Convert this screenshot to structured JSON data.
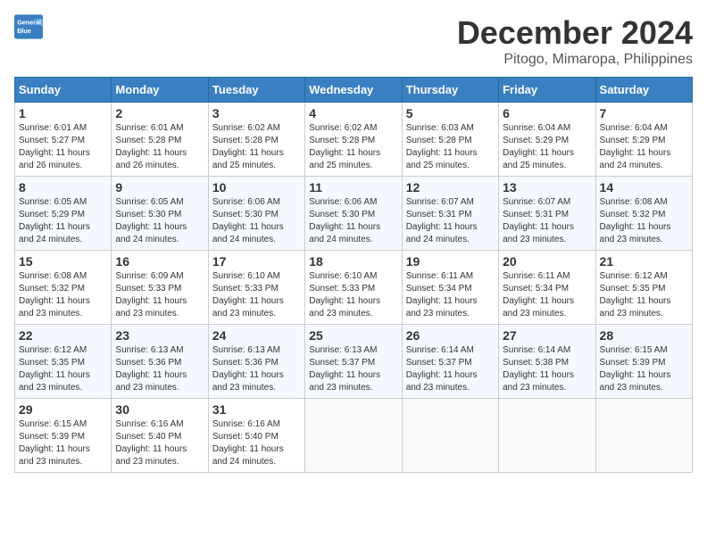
{
  "logo": {
    "line1": "General",
    "line2": "Blue"
  },
  "title": "December 2024",
  "subtitle": "Pitogo, Mimaropa, Philippines",
  "headers": [
    "Sunday",
    "Monday",
    "Tuesday",
    "Wednesday",
    "Thursday",
    "Friday",
    "Saturday"
  ],
  "weeks": [
    [
      {
        "day": "1",
        "info": "Sunrise: 6:01 AM\nSunset: 5:27 PM\nDaylight: 11 hours\nand 26 minutes."
      },
      {
        "day": "2",
        "info": "Sunrise: 6:01 AM\nSunset: 5:28 PM\nDaylight: 11 hours\nand 26 minutes."
      },
      {
        "day": "3",
        "info": "Sunrise: 6:02 AM\nSunset: 5:28 PM\nDaylight: 11 hours\nand 25 minutes."
      },
      {
        "day": "4",
        "info": "Sunrise: 6:02 AM\nSunset: 5:28 PM\nDaylight: 11 hours\nand 25 minutes."
      },
      {
        "day": "5",
        "info": "Sunrise: 6:03 AM\nSunset: 5:28 PM\nDaylight: 11 hours\nand 25 minutes."
      },
      {
        "day": "6",
        "info": "Sunrise: 6:04 AM\nSunset: 5:29 PM\nDaylight: 11 hours\nand 25 minutes."
      },
      {
        "day": "7",
        "info": "Sunrise: 6:04 AM\nSunset: 5:29 PM\nDaylight: 11 hours\nand 24 minutes."
      }
    ],
    [
      {
        "day": "8",
        "info": "Sunrise: 6:05 AM\nSunset: 5:29 PM\nDaylight: 11 hours\nand 24 minutes."
      },
      {
        "day": "9",
        "info": "Sunrise: 6:05 AM\nSunset: 5:30 PM\nDaylight: 11 hours\nand 24 minutes."
      },
      {
        "day": "10",
        "info": "Sunrise: 6:06 AM\nSunset: 5:30 PM\nDaylight: 11 hours\nand 24 minutes."
      },
      {
        "day": "11",
        "info": "Sunrise: 6:06 AM\nSunset: 5:30 PM\nDaylight: 11 hours\nand 24 minutes."
      },
      {
        "day": "12",
        "info": "Sunrise: 6:07 AM\nSunset: 5:31 PM\nDaylight: 11 hours\nand 24 minutes."
      },
      {
        "day": "13",
        "info": "Sunrise: 6:07 AM\nSunset: 5:31 PM\nDaylight: 11 hours\nand 23 minutes."
      },
      {
        "day": "14",
        "info": "Sunrise: 6:08 AM\nSunset: 5:32 PM\nDaylight: 11 hours\nand 23 minutes."
      }
    ],
    [
      {
        "day": "15",
        "info": "Sunrise: 6:08 AM\nSunset: 5:32 PM\nDaylight: 11 hours\nand 23 minutes."
      },
      {
        "day": "16",
        "info": "Sunrise: 6:09 AM\nSunset: 5:33 PM\nDaylight: 11 hours\nand 23 minutes."
      },
      {
        "day": "17",
        "info": "Sunrise: 6:10 AM\nSunset: 5:33 PM\nDaylight: 11 hours\nand 23 minutes."
      },
      {
        "day": "18",
        "info": "Sunrise: 6:10 AM\nSunset: 5:33 PM\nDaylight: 11 hours\nand 23 minutes."
      },
      {
        "day": "19",
        "info": "Sunrise: 6:11 AM\nSunset: 5:34 PM\nDaylight: 11 hours\nand 23 minutes."
      },
      {
        "day": "20",
        "info": "Sunrise: 6:11 AM\nSunset: 5:34 PM\nDaylight: 11 hours\nand 23 minutes."
      },
      {
        "day": "21",
        "info": "Sunrise: 6:12 AM\nSunset: 5:35 PM\nDaylight: 11 hours\nand 23 minutes."
      }
    ],
    [
      {
        "day": "22",
        "info": "Sunrise: 6:12 AM\nSunset: 5:35 PM\nDaylight: 11 hours\nand 23 minutes."
      },
      {
        "day": "23",
        "info": "Sunrise: 6:13 AM\nSunset: 5:36 PM\nDaylight: 11 hours\nand 23 minutes."
      },
      {
        "day": "24",
        "info": "Sunrise: 6:13 AM\nSunset: 5:36 PM\nDaylight: 11 hours\nand 23 minutes."
      },
      {
        "day": "25",
        "info": "Sunrise: 6:13 AM\nSunset: 5:37 PM\nDaylight: 11 hours\nand 23 minutes."
      },
      {
        "day": "26",
        "info": "Sunrise: 6:14 AM\nSunset: 5:37 PM\nDaylight: 11 hours\nand 23 minutes."
      },
      {
        "day": "27",
        "info": "Sunrise: 6:14 AM\nSunset: 5:38 PM\nDaylight: 11 hours\nand 23 minutes."
      },
      {
        "day": "28",
        "info": "Sunrise: 6:15 AM\nSunset: 5:39 PM\nDaylight: 11 hours\nand 23 minutes."
      }
    ],
    [
      {
        "day": "29",
        "info": "Sunrise: 6:15 AM\nSunset: 5:39 PM\nDaylight: 11 hours\nand 23 minutes."
      },
      {
        "day": "30",
        "info": "Sunrise: 6:16 AM\nSunset: 5:40 PM\nDaylight: 11 hours\nand 23 minutes."
      },
      {
        "day": "31",
        "info": "Sunrise: 6:16 AM\nSunset: 5:40 PM\nDaylight: 11 hours\nand 24 minutes."
      },
      {
        "day": "",
        "info": ""
      },
      {
        "day": "",
        "info": ""
      },
      {
        "day": "",
        "info": ""
      },
      {
        "day": "",
        "info": ""
      }
    ]
  ]
}
